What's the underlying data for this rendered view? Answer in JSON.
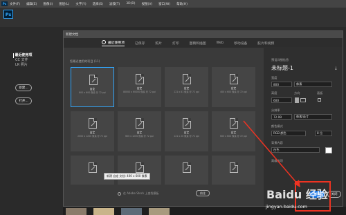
{
  "menubar": {
    "logo": "Ps",
    "items": [
      "文件(F)",
      "编辑(E)",
      "图像(I)",
      "图层(L)",
      "文字(Y)",
      "选择(S)",
      "滤镜(T)",
      "3D(D)",
      "视图(V)",
      "窗口(W)",
      "帮助(H)"
    ]
  },
  "home": {
    "logo": "Ps"
  },
  "leftnav": {
    "items": [
      "最近使用项",
      "CC 文件",
      "LR 照片"
    ],
    "new_button": "新建...",
    "open_button": "打开..."
  },
  "dialog": {
    "title": "新建文档",
    "tabs": [
      "最近使用项",
      "已保存",
      "照片",
      "打印",
      "图稿和插图",
      "Web",
      "移动设备",
      "胶片和视频"
    ],
    "recent_heading": "您最近使用的项目 (11)",
    "cards": [
      {
        "name": "自定",
        "sub": "800 x 600 像素 @ 72 ppi"
      },
      {
        "name": "自定",
        "sub": "80000 x 60000 像素 @ 72 ppi"
      },
      {
        "name": "自定",
        "sub": "121 x 81 像素 @ 72 ppi"
      },
      {
        "name": "自定",
        "sub": "400 x 600 像素 @ 72 ppi"
      },
      {
        "name": "自定",
        "sub": "2000 x 1200 像素 @ 72 ppi"
      },
      {
        "name": "自定",
        "sub": "600 x 1200 像素 @ 72 ppi"
      },
      {
        "name": "自定",
        "sub": "121 x 20 像素 @ 72 ppi"
      },
      {
        "name": "自定",
        "sub": "600 x 600 像素 @ 72 ppi"
      },
      {
        "name": "",
        "sub": ""
      },
      {
        "name": "",
        "sub": ""
      },
      {
        "name": "",
        "sub": ""
      },
      {
        "name": "",
        "sub": ""
      }
    ],
    "tooltip": "新建 自定 文档: 400 x 600 像素",
    "search_placeholder": "在 Adobe Stock 上查找模板",
    "search_button": "前往",
    "details": {
      "heading": "预设详细信息",
      "doc_name": "未标题-1",
      "width_label": "宽度",
      "width_value": "800",
      "width_unit": "像素",
      "height_label": "高度",
      "height_value": "600",
      "orientation_label": "方向",
      "artboard_label": "画板",
      "resolution_label": "分辨率",
      "resolution_value": "72.99",
      "resolution_unit": "像素/英寸",
      "color_mode_label": "颜色模式",
      "color_mode_value": "RGB 颜色",
      "bit_depth": "8 位",
      "background_label": "背景内容",
      "background_value": "白色",
      "advanced_label": "高级选项"
    },
    "create_button": "创建",
    "close_button": "关闭"
  },
  "watermark": {
    "main": "Baidu 经验",
    "sub": "jingyan.baidu.com"
  },
  "colors": {
    "accent": "#1473e6",
    "highlight": "#e32",
    "ps_blue": "#31a8ff"
  }
}
